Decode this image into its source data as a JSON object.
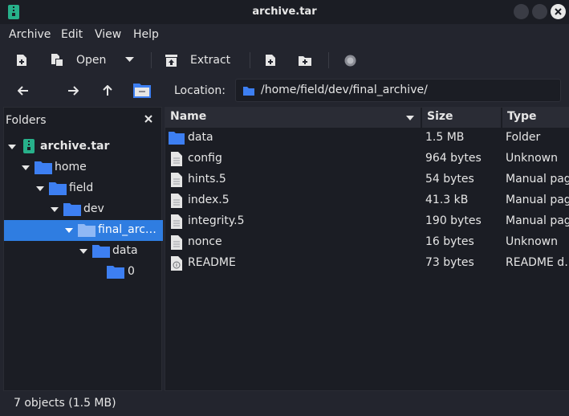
{
  "window": {
    "title": "archive.tar"
  },
  "menu": {
    "archive": "Archive",
    "edit": "Edit",
    "view": "View",
    "help": "Help"
  },
  "toolbar": {
    "open_label": "Open",
    "extract_label": "Extract"
  },
  "location": {
    "label": "Location:",
    "path": "/home/field/dev/final_archive/"
  },
  "folders": {
    "title": "Folders",
    "tree": [
      {
        "label": "archive.tar"
      },
      {
        "label": "home"
      },
      {
        "label": "field"
      },
      {
        "label": "dev"
      },
      {
        "label": "final_arc…"
      },
      {
        "label": "data"
      },
      {
        "label": "0"
      }
    ]
  },
  "files": {
    "columns": {
      "name": "Name",
      "size": "Size",
      "type": "Type"
    },
    "rows": [
      {
        "name": "data",
        "size": "1.5 MB",
        "type": "Folder",
        "icon": "folder-icon"
      },
      {
        "name": "config",
        "size": "964 bytes",
        "type": "Unknown",
        "icon": "document-icon"
      },
      {
        "name": "hints.5",
        "size": "54 bytes",
        "type": "Manual page",
        "icon": "document-icon"
      },
      {
        "name": "index.5",
        "size": "41.3 kB",
        "type": "Manual page",
        "icon": "document-icon"
      },
      {
        "name": "integrity.5",
        "size": "190 bytes",
        "type": "Manual page",
        "icon": "document-icon"
      },
      {
        "name": "nonce",
        "size": "16 bytes",
        "type": "Unknown",
        "icon": "document-icon"
      },
      {
        "name": "README",
        "size": "73 bytes",
        "type": "README d…",
        "icon": "info-document-icon"
      }
    ]
  },
  "status": {
    "text": "7 objects (1.5 MB)"
  },
  "colors": {
    "accent": "#2f7de1",
    "folder": "#3d7ff2",
    "background": "#23252e",
    "pane": "#1b1d24"
  }
}
